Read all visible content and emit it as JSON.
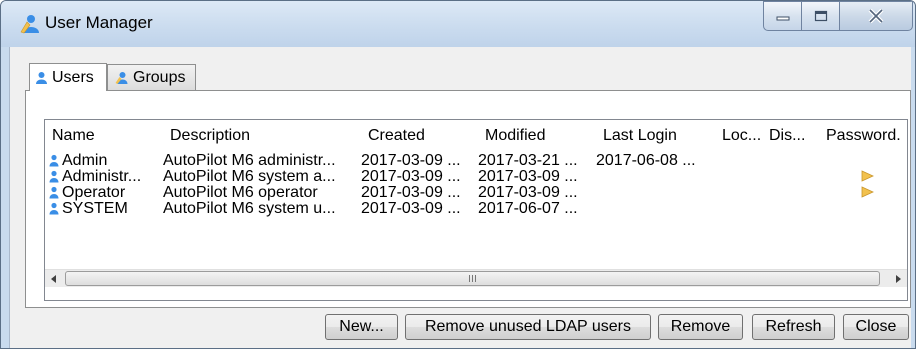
{
  "window": {
    "title": "User Manager",
    "controls": {
      "minimize": "minimize-icon",
      "maximize": "maximize-icon",
      "close": "close-icon"
    }
  },
  "tabs": [
    {
      "label": "Users",
      "icon": "user-icon",
      "selected": true
    },
    {
      "label": "Groups",
      "icon": "group-icon",
      "selected": false
    }
  ],
  "table": {
    "columns": [
      "Name",
      "Description",
      "Created",
      "Modified",
      "Last Login",
      "Loc...",
      "Dis...",
      "Password."
    ],
    "rows": [
      {
        "name": "Admin",
        "description": "AutoPilot M6 administr...",
        "created": "2017-03-09 ...",
        "modified": "2017-03-21 ...",
        "last_login": "2017-06-08 ...",
        "password_flag": false
      },
      {
        "name": "Administr...",
        "description": "AutoPilot M6 system a...",
        "created": "2017-03-09 ...",
        "modified": "2017-03-09 ...",
        "last_login": "",
        "password_flag": true
      },
      {
        "name": "Operator",
        "description": "AutoPilot M6 operator",
        "created": "2017-03-09 ...",
        "modified": "2017-03-09 ...",
        "last_login": "",
        "password_flag": true
      },
      {
        "name": "SYSTEM",
        "description": "AutoPilot M6 system u...",
        "created": "2017-03-09 ...",
        "modified": "2017-06-07 ...",
        "last_login": "",
        "password_flag": false
      }
    ]
  },
  "buttons": {
    "new": "New...",
    "remove_ldap": "Remove unused LDAP users",
    "remove": "Remove",
    "refresh": "Refresh",
    "close": "Close"
  },
  "colors": {
    "title_bar": "#cbdcef",
    "user_icon": "#3a8ee6",
    "password_icon": "#f2c14e"
  }
}
